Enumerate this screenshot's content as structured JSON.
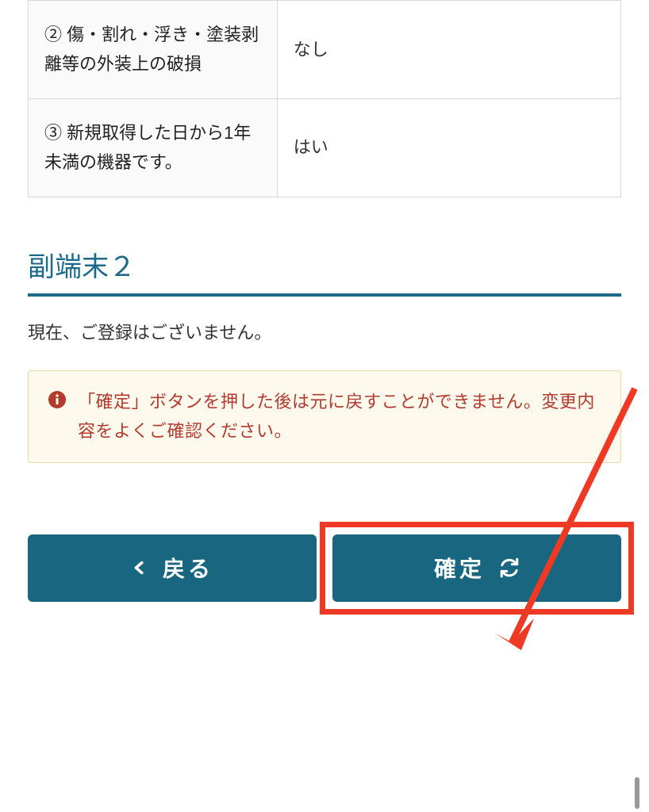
{
  "table": {
    "rows": [
      {
        "label": "② 傷・割れ・浮き・塗装剥離等の外装上の破損",
        "value": "なし"
      },
      {
        "label": "③ 新規取得した日から1年未満の機器です。",
        "value": "はい"
      }
    ]
  },
  "section": {
    "title": "副端末２",
    "no_registration_text": "現在、ご登録はございません。"
  },
  "warning": {
    "text": "「確定」ボタンを押した後は元に戻すことができません。変更内容をよくご確認ください。"
  },
  "buttons": {
    "back_label": "戻る",
    "confirm_label": "確定"
  },
  "colors": {
    "primary": "#18667f",
    "section_heading": "#1c6a89",
    "warning_text": "#b43a2e",
    "warning_bg": "#fdf9ec",
    "highlight": "#ee3a24"
  }
}
